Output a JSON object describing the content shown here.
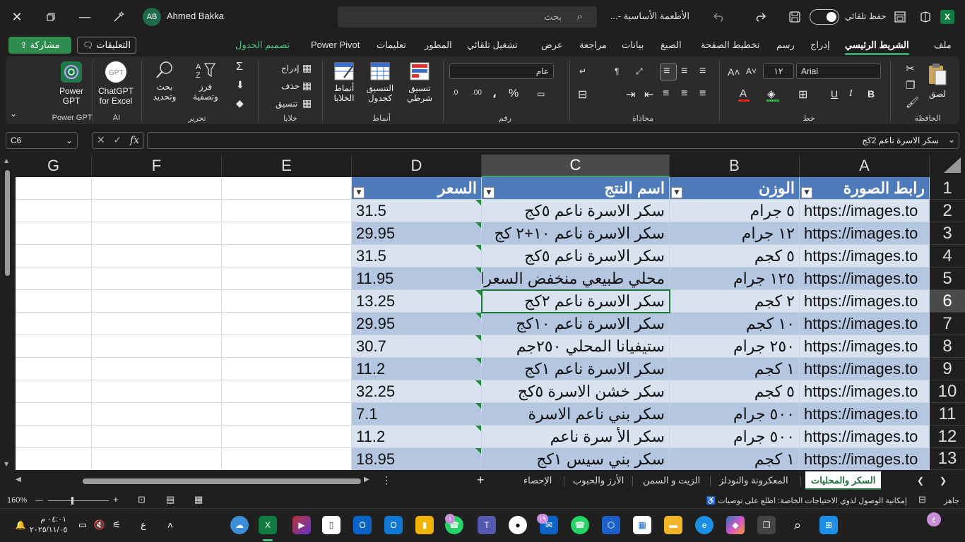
{
  "titlebar": {
    "user_name": "Ahmed Bakka",
    "user_initials": "AB",
    "search_placeholder": "بحث",
    "doc_title": "الأطعمة الأساسية -...",
    "autosave_label": "حفظ تلقائي",
    "app_logo": "X"
  },
  "ribbon_tabs": {
    "file": "ملف",
    "home": "الشريط الرئيسي",
    "insert": "إدراج",
    "draw": "رسم",
    "page_layout": "تخطيط الصفحة",
    "formulas": "الصيغ",
    "data": "بيانات",
    "review": "مراجعة",
    "view": "عرض",
    "automate": "تشغيل تلقائي",
    "developer": "المطور",
    "help": "تعليمات",
    "power_pivot": "Power Pivot",
    "table_design": "تصميم الجدول",
    "comments": "التعليقات",
    "share": "مشاركة"
  },
  "ribbon": {
    "clipboard": {
      "paste": "لصق",
      "label": "الحافظة"
    },
    "font": {
      "name": "Arial",
      "size": "١٢",
      "label": "خط"
    },
    "alignment": {
      "label": "محاذاة"
    },
    "number": {
      "format": "عام",
      "label": "رقم"
    },
    "styles": {
      "conditional": "تنسيق شرطي",
      "format_table": "التنسيق كجدول",
      "cell_styles": "أنماط الخلايا",
      "label": "أنماط"
    },
    "cells": {
      "insert": "إدراج",
      "delete": "حذف",
      "format": "تنسيق",
      "label": "خلايا"
    },
    "editing": {
      "sort_filter": "فرز وتصفية",
      "find_select": "بحث وتحديد",
      "label": "تحرير"
    },
    "ai": {
      "chatgpt": "ChatGPT for Excel",
      "label": "AI"
    },
    "power_gpt": {
      "btn": "Power GPT",
      "label": "Power GPT"
    }
  },
  "formula_bar": {
    "name_box": "C6",
    "formula": "سكر الاسرة ناعم 2كج"
  },
  "columns": [
    "A",
    "B",
    "C",
    "D",
    "E",
    "F",
    "G"
  ],
  "rows": [
    "1",
    "2",
    "3",
    "4",
    "5",
    "6",
    "7",
    "8",
    "9",
    "10",
    "11",
    "12",
    "13"
  ],
  "table": {
    "headers": [
      "رابط الصورة",
      "الوزن",
      "اسم النتج",
      "السعر"
    ],
    "data": [
      [
        "https://images.to",
        "٥ جرام",
        "سكر الاسرة ناعم ٥كج",
        "31.5"
      ],
      [
        "https://images.to",
        "١٢ جرام",
        "سكر الاسرة ناعم ١٠+٢ كج",
        "29.95"
      ],
      [
        "https://images.to",
        "٥ كجم",
        "سكر الاسرة ناعم ٥كج",
        "31.5"
      ],
      [
        "https://images.to",
        "١٢٥ جرام",
        "محلي طبيعي منخفض السعرات",
        "11.95"
      ],
      [
        "https://images.to",
        "٢ كجم",
        "سكر الاسرة ناعم ٢كج",
        "13.25"
      ],
      [
        "https://images.to",
        "١٠ كجم",
        "سكر الاسرة ناعم ١٠كج",
        "29.95"
      ],
      [
        "https://images.to",
        "٢٥٠ جرام",
        "ستيفيانا المحلي ٢٥٠جم",
        "30.7"
      ],
      [
        "https://images.to",
        "١ كجم",
        "سكر الاسرة ناعم ١كج",
        "11.2"
      ],
      [
        "https://images.to",
        "٥ كجم",
        "سكر خشن الاسرة ٥كج",
        "32.25"
      ],
      [
        "https://images.to",
        "٥٠٠ جرام",
        "سكر بني ناعم الاسرة",
        "7.1"
      ],
      [
        "https://images.to",
        "٥٠٠ جرام",
        "سكر الأ سرة ناعم",
        "11.2"
      ],
      [
        "https://images.to",
        "١ كجم",
        "سكر بني سيس ١كج",
        "18.95"
      ]
    ]
  },
  "sheet_tabs": [
    "السكر والمحليات",
    "المعكرونة والنودلز",
    "الزيت و السمن",
    "الأرز والحبوب",
    "الإحصاء"
  ],
  "statusbar": {
    "ready": "جاهز",
    "accessibility": "إمكانية الوصول لذوي الاحتياجات الخاصة: اطلع على توصيات",
    "zoom": "160%"
  },
  "taskbar": {
    "time": "٠٤:٠١ م",
    "date": "٢٠٢٥/١١/٠٥",
    "lang": "ع",
    "badge_notif": "٤",
    "badge_teams": "١",
    "badge_mail": "١٩"
  },
  "colors": {
    "header_fill": "#4f7bbb",
    "band_light": "#d9e2ef",
    "band_dark": "#b4c6e0",
    "accent": "#3ea56b"
  }
}
